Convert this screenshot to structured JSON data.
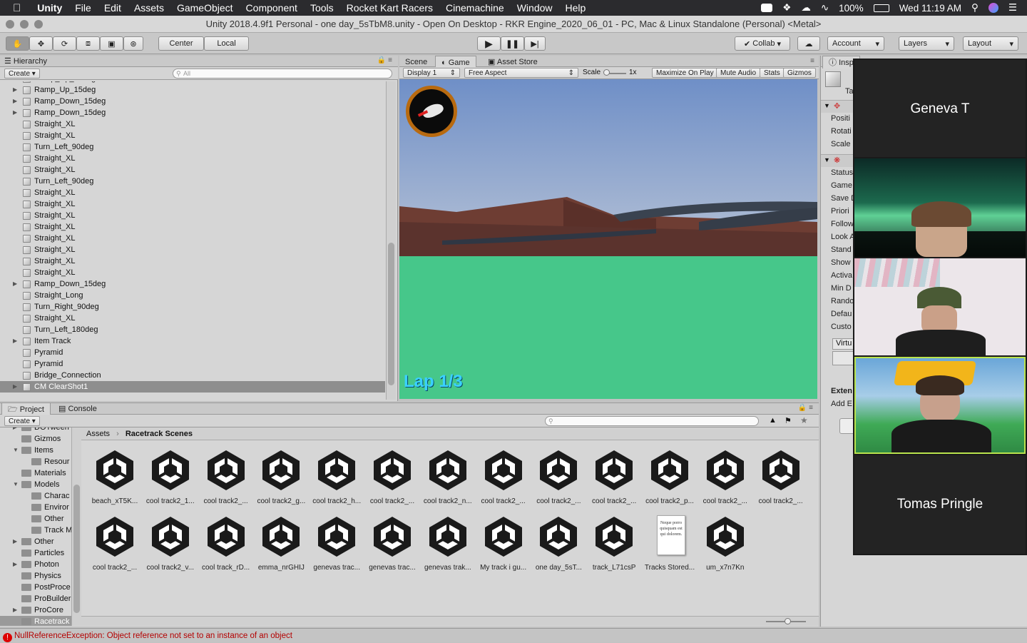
{
  "menubar": {
    "apple": "",
    "items": [
      "Unity",
      "File",
      "Edit",
      "Assets",
      "GameObject",
      "Component",
      "Tools",
      "Rocket Kart Racers",
      "Cinemachine",
      "Window",
      "Help"
    ],
    "battery": "100%",
    "clock": "Wed 11:19 AM"
  },
  "window": {
    "title": "Unity 2018.4.9f1 Personal - one day_5sTbM8.unity - Open On Desktop - RKR Engine_2020_06_01 - PC, Mac & Linux Standalone (Personal) <Metal>"
  },
  "toolbar": {
    "pivot_center": "Center",
    "pivot_local": "Local",
    "collab": "Collab",
    "account": "Account",
    "layers": "Layers",
    "layout": "Layout"
  },
  "hierarchy": {
    "tab": "Hierarchy",
    "create": "Create",
    "search_placeholder": "All",
    "rows": [
      {
        "label": "Ramp_Up_15deg",
        "arrow": true
      },
      {
        "label": "Ramp_Up_15deg",
        "arrow": true
      },
      {
        "label": "Ramp_Down_15deg",
        "arrow": true
      },
      {
        "label": "Ramp_Down_15deg",
        "arrow": true
      },
      {
        "label": "Straight_XL",
        "arrow": false
      },
      {
        "label": "Straight_XL",
        "arrow": false
      },
      {
        "label": "Turn_Left_90deg",
        "arrow": false
      },
      {
        "label": "Straight_XL",
        "arrow": false
      },
      {
        "label": "Straight_XL",
        "arrow": false
      },
      {
        "label": "Turn_Left_90deg",
        "arrow": false
      },
      {
        "label": "Straight_XL",
        "arrow": false
      },
      {
        "label": "Straight_XL",
        "arrow": false
      },
      {
        "label": "Straight_XL",
        "arrow": false
      },
      {
        "label": "Straight_XL",
        "arrow": false
      },
      {
        "label": "Straight_XL",
        "arrow": false
      },
      {
        "label": "Straight_XL",
        "arrow": false
      },
      {
        "label": "Straight_XL",
        "arrow": false
      },
      {
        "label": "Straight_XL",
        "arrow": false
      },
      {
        "label": "Ramp_Down_15deg",
        "arrow": true
      },
      {
        "label": "Straight_Long",
        "arrow": false
      },
      {
        "label": "Turn_Right_90deg",
        "arrow": false
      },
      {
        "label": "Straight_XL",
        "arrow": false
      },
      {
        "label": "Turn_Left_180deg",
        "arrow": false
      },
      {
        "label": "Item Track",
        "arrow": true
      },
      {
        "label": "Pyramid",
        "arrow": false
      },
      {
        "label": "Pyramid",
        "arrow": false
      },
      {
        "label": "Bridge_Connection",
        "arrow": false
      },
      {
        "label": "CM ClearShot1",
        "arrow": true,
        "selected": true
      }
    ]
  },
  "game": {
    "tabs": [
      "Scene",
      "Game",
      "Asset Store"
    ],
    "active_tab": "Game",
    "display": "Display 1",
    "aspect": "Free Aspect",
    "scale_label": "Scale",
    "scale_value": "1x",
    "toggles": [
      "Maximize On Play",
      "Mute Audio",
      "Stats",
      "Gizmos"
    ],
    "lap": "Lap 1/3"
  },
  "inspector": {
    "tab": "Insp",
    "obj_label": "Ta",
    "transform_fields": [
      "Positi",
      "Rotati",
      "Scale"
    ],
    "component_fields": [
      "Status",
      "Game",
      "Save D",
      "Priori",
      "Follow",
      "Look A",
      "Stand",
      "Show",
      "Activa",
      "Min D",
      "Rando",
      "Defau",
      "Custo"
    ],
    "virtual": "Virtu",
    "extensions": "Exten",
    "add_ext": "Add E"
  },
  "project": {
    "tabs": [
      "Project",
      "Console"
    ],
    "create": "Create",
    "folders": [
      {
        "label": "DOTween",
        "indent": 1,
        "arrow": "right"
      },
      {
        "label": "Gizmos",
        "indent": 1,
        "arrow": ""
      },
      {
        "label": "Items",
        "indent": 1,
        "arrow": "down"
      },
      {
        "label": "Resour",
        "indent": 2,
        "arrow": ""
      },
      {
        "label": "Materials",
        "indent": 1,
        "arrow": ""
      },
      {
        "label": "Models",
        "indent": 1,
        "arrow": "down"
      },
      {
        "label": "Charac",
        "indent": 2,
        "arrow": ""
      },
      {
        "label": "Enviror",
        "indent": 2,
        "arrow": ""
      },
      {
        "label": "Other",
        "indent": 2,
        "arrow": ""
      },
      {
        "label": "Track M",
        "indent": 2,
        "arrow": ""
      },
      {
        "label": "Other",
        "indent": 1,
        "arrow": "right"
      },
      {
        "label": "Particles",
        "indent": 1,
        "arrow": ""
      },
      {
        "label": "Photon",
        "indent": 1,
        "arrow": "right"
      },
      {
        "label": "Physics",
        "indent": 1,
        "arrow": ""
      },
      {
        "label": "PostProce",
        "indent": 1,
        "arrow": ""
      },
      {
        "label": "ProBuilder",
        "indent": 1,
        "arrow": ""
      },
      {
        "label": "ProCore",
        "indent": 1,
        "arrow": "right"
      },
      {
        "label": "Racetrack",
        "indent": 1,
        "arrow": "",
        "selected": true
      }
    ],
    "breadcrumb_root": "Assets",
    "breadcrumb_current": "Racetrack Scenes",
    "assets_row1": [
      "beach_xT5K...",
      "cool track2_1...",
      "cool track2_...",
      "cool track2_g...",
      "cool track2_h...",
      "cool track2_...",
      "cool track2_n...",
      "cool track2_...",
      "cool track2_...",
      "cool track2_...",
      "cool track2_p...",
      "cool track2_...",
      "cool track2_..."
    ],
    "assets_row2": [
      "cool track2_...",
      "cool track2_v...",
      "cool track_rD...",
      "emma_nrGHIJ",
      "genevas trac...",
      "genevas trac...",
      "genevas trak...",
      "My track i gu...",
      "one day_5sT...",
      "track_L71csP",
      "Tracks Stored...",
      "um_x7n7Kn"
    ],
    "doc_preview": "Neque porro quisquam est qui dolorem."
  },
  "status": {
    "error": "NullReferenceException: Object reference not set to an instance of an object"
  },
  "video_call": {
    "participants": [
      "Geneva T",
      "",
      "",
      "",
      "Tomas Pringle"
    ]
  }
}
